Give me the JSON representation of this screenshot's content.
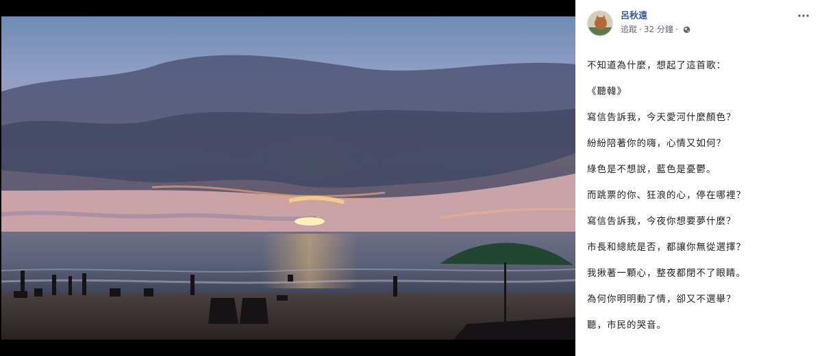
{
  "post": {
    "author": "呂秋遠",
    "audience_label": "追蹤",
    "separator": "·",
    "time": "32 分鐘",
    "separator2": "·",
    "privacy_icon": "globe-icon",
    "more_icon": "more-options-icon",
    "lines": [
      "不知道為什麼，想起了這首歌：",
      "《聽韓》",
      "寫信告訴我，今天愛河什麼顏色？",
      "紛紛陪著你的嗨，心情又如何？",
      "綠色是不想說，藍色是憂鬱。",
      "而跳票的你、狂浪的心，停在哪裡？",
      "寫信告訴我，今夜你想要夢什麼？",
      "市長和總統是否，都讓你無從選擇？",
      "我揪著一顆心，整夜都閉不了眼睛。",
      "為何你明明動了情，卻又不選舉？",
      "聽，市民的哭音。"
    ]
  },
  "photo": {
    "subject": "sunset-beach-photo"
  },
  "colors": {
    "author_link": "#385898",
    "secondary_text": "#606770",
    "body_text": "#1c1e21",
    "photo_frame": "#000000"
  }
}
